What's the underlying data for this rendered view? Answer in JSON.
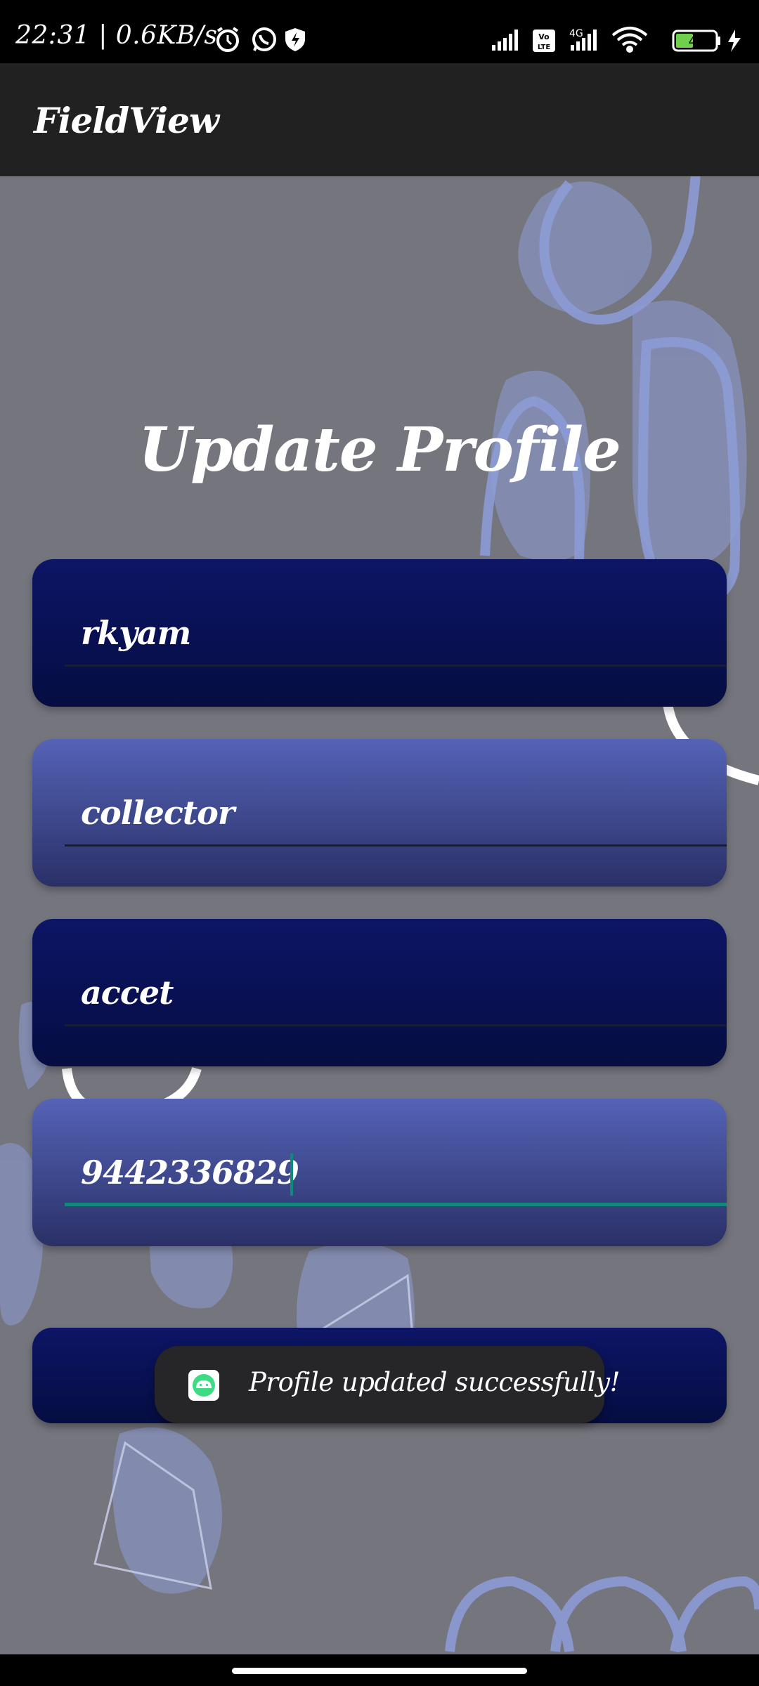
{
  "status_bar": {
    "time": "22:31",
    "network_speed": "0.6KB/s",
    "battery_level": "40",
    "icons_left": [
      "alarm-icon",
      "whatsapp-icon",
      "shield-icon"
    ],
    "icons_right": [
      "signal-icon",
      "volte-icon",
      "signal-4g-icon",
      "wifi-icon",
      "battery-icon",
      "charging-icon"
    ]
  },
  "app_bar": {
    "title": "FieldView"
  },
  "page": {
    "title": "Update Profile"
  },
  "form": {
    "fields": [
      {
        "name": "username",
        "value": "rkyam",
        "focused": false
      },
      {
        "name": "role",
        "value": "collector",
        "focused": false
      },
      {
        "name": "organization",
        "value": "accet",
        "focused": false
      },
      {
        "name": "phone",
        "value": "9442336829",
        "focused": true
      }
    ],
    "submit_label": ""
  },
  "toast": {
    "message": "Profile updated successfully!",
    "icon": "android-icon"
  },
  "colors": {
    "background": "#75757e",
    "app_bar": "#212121",
    "card_dark": "#0d1566",
    "card_light": "#5463b7",
    "accent": "#0f8a78",
    "blob": "#8d9bd6"
  }
}
